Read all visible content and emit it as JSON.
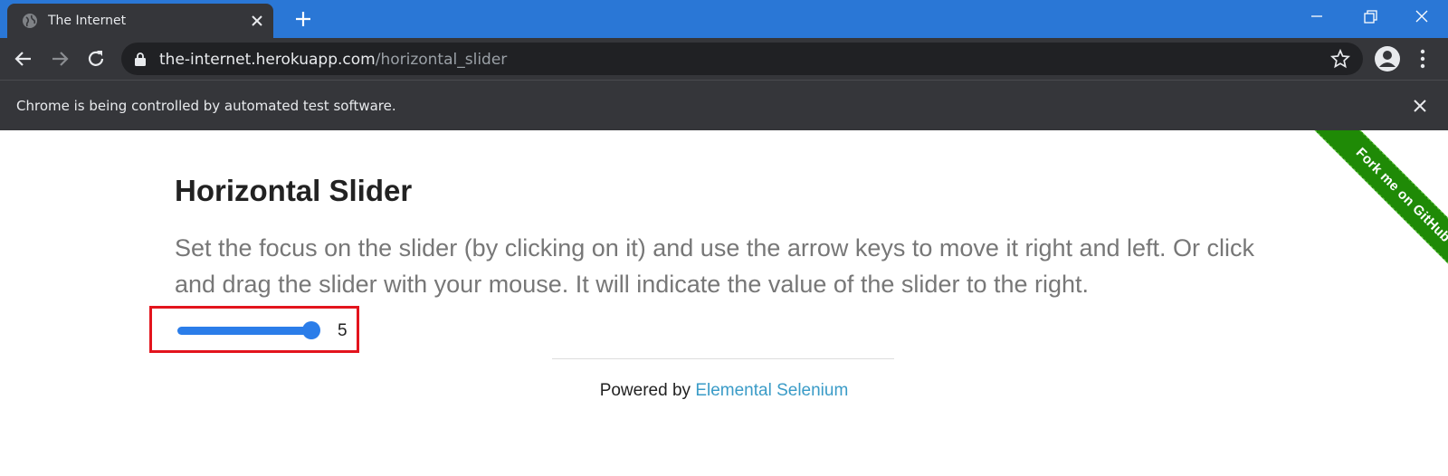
{
  "browser": {
    "tab_title": "The Internet",
    "url_host": "the-internet.herokuapp.com",
    "url_path": "/horizontal_slider",
    "infobar_text": "Chrome is being controlled by automated test software."
  },
  "ribbon": {
    "text": "Fork me on GitHub"
  },
  "page": {
    "heading": "Horizontal Slider",
    "description": "Set the focus on the slider (by clicking on it) and use the arrow keys to move it right and left. Or click and drag the slider with your mouse. It will indicate the value of the slider to the right.",
    "slider_value": "5"
  },
  "footer": {
    "prefix": "Powered by ",
    "link_text": "Elemental Selenium"
  },
  "colors": {
    "titlebar": "#2a77d6",
    "accent_slider": "#2b7de9",
    "highlight_box": "#e3141d",
    "ribbon": "#1f8a06",
    "link": "#3a9bc7"
  }
}
